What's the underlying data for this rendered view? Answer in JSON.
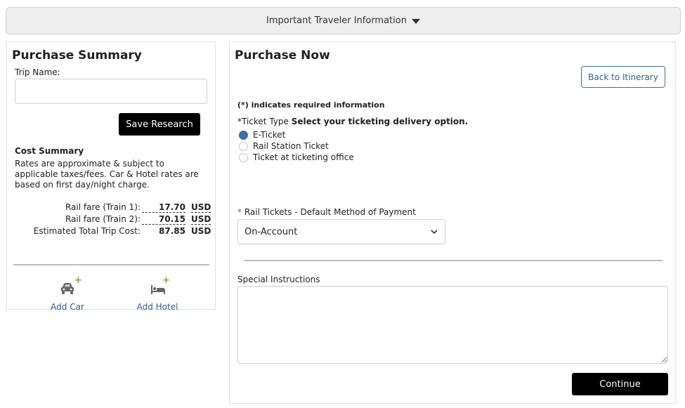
{
  "info_bar": {
    "label": "Important Traveler Information"
  },
  "summary": {
    "title": "Purchase Summary",
    "trip_name_label": "Trip Name:",
    "trip_name_value": "",
    "save_button": "Save Research",
    "cost_heading": "Cost Summary",
    "cost_note": "Rates are approximate & subject to applicable taxes/fees. Car & Hotel rates are based on first day/night charge.",
    "costs": [
      {
        "label": "Rail fare (Train 1):",
        "amount": "17.70",
        "currency": "USD"
      },
      {
        "label": "Rail fare (Train 2):",
        "amount": "70.15",
        "currency": "USD"
      },
      {
        "label": "Estimated Total Trip Cost:",
        "amount": "87.85",
        "currency": "USD"
      }
    ],
    "add_car": "Add Car",
    "add_hotel": "Add Hotel",
    "plus": "+"
  },
  "purchase": {
    "title": "Purchase Now",
    "back_button": "Back to Itinerary",
    "required_note": "(*) indicates required information",
    "ticket_type_label": "*Ticket Type",
    "ticket_type_prompt": "Select your ticketing delivery option.",
    "ticket_options": [
      {
        "label": "E-Ticket",
        "checked": true
      },
      {
        "label": "Rail Station Ticket",
        "checked": false
      },
      {
        "label": "Ticket at ticketing office",
        "checked": false
      }
    ],
    "payment_star": "*",
    "payment_label": "Rail Tickets - Default Method of Payment",
    "payment_value": "On-Account",
    "special_label": "Special Instructions",
    "special_value": "",
    "continue_button": "Continue"
  },
  "colors": {
    "accent": "#3f6fa5",
    "link": "#2f5f8f",
    "plus_green": "#72a832",
    "button_black": "#000000"
  }
}
